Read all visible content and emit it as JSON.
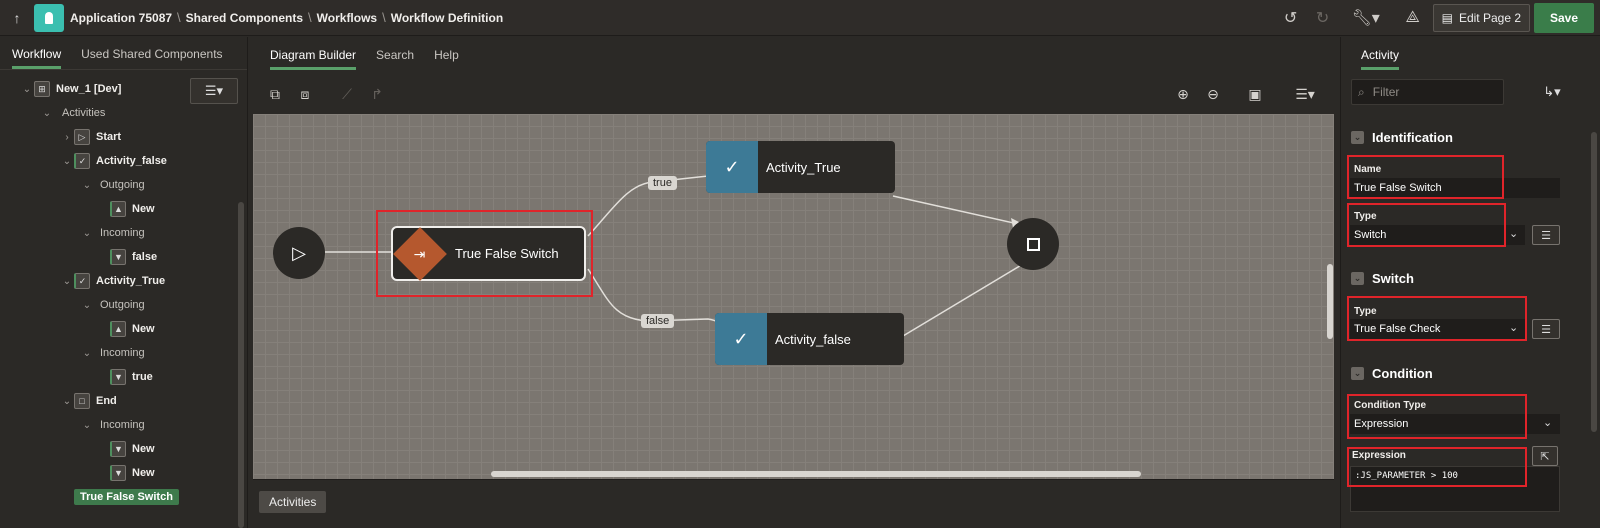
{
  "breadcrumb": {
    "app": "Application 75087",
    "items": [
      "Shared Components",
      "Workflows",
      "Workflow Definition"
    ]
  },
  "toolbar": {
    "edit_page_label": "Edit Page 2",
    "save_label": "Save"
  },
  "left_panel": {
    "tabs": [
      "Workflow",
      "Used Shared Components"
    ],
    "active_tab": "Workflow",
    "tree": {
      "root": "New_1 [Dev]",
      "activities_label": "Activities",
      "start": "Start",
      "activity_false": "Activity_false",
      "outgoing": "Outgoing",
      "incoming": "Incoming",
      "new": "New",
      "false": "false",
      "activity_true": "Activity_True",
      "true": "true",
      "end": "End",
      "switch": "True False Switch"
    }
  },
  "center": {
    "tabs": [
      "Diagram Builder",
      "Search",
      "Help"
    ],
    "active_tab": "Diagram Builder",
    "bottom_tab": "Activities",
    "nodes": {
      "switch": "True False Switch",
      "activity_true": "Activity_True",
      "activity_false": "Activity_false"
    },
    "edge_labels": {
      "true": "true",
      "false": "false"
    }
  },
  "right_panel": {
    "tab": "Activity",
    "filter_placeholder": "Filter",
    "sections": {
      "identification": "Identification",
      "switch": "Switch",
      "condition": "Condition"
    },
    "props": {
      "name_label": "Name",
      "name_value": "True False Switch",
      "type_label": "Type",
      "type_value": "Switch",
      "switch_type_label": "Type",
      "switch_type_value": "True False Check",
      "condition_type_label": "Condition Type",
      "condition_type_value": "Expression",
      "expression_label": "Expression",
      "expression_value": ":JS_PARAMETER > 100"
    }
  },
  "colors": {
    "accent_green": "#3a7d4a",
    "activity_blue": "#3d7a96",
    "switch_orange": "#b5582e",
    "highlight_red": "#e0242a"
  }
}
